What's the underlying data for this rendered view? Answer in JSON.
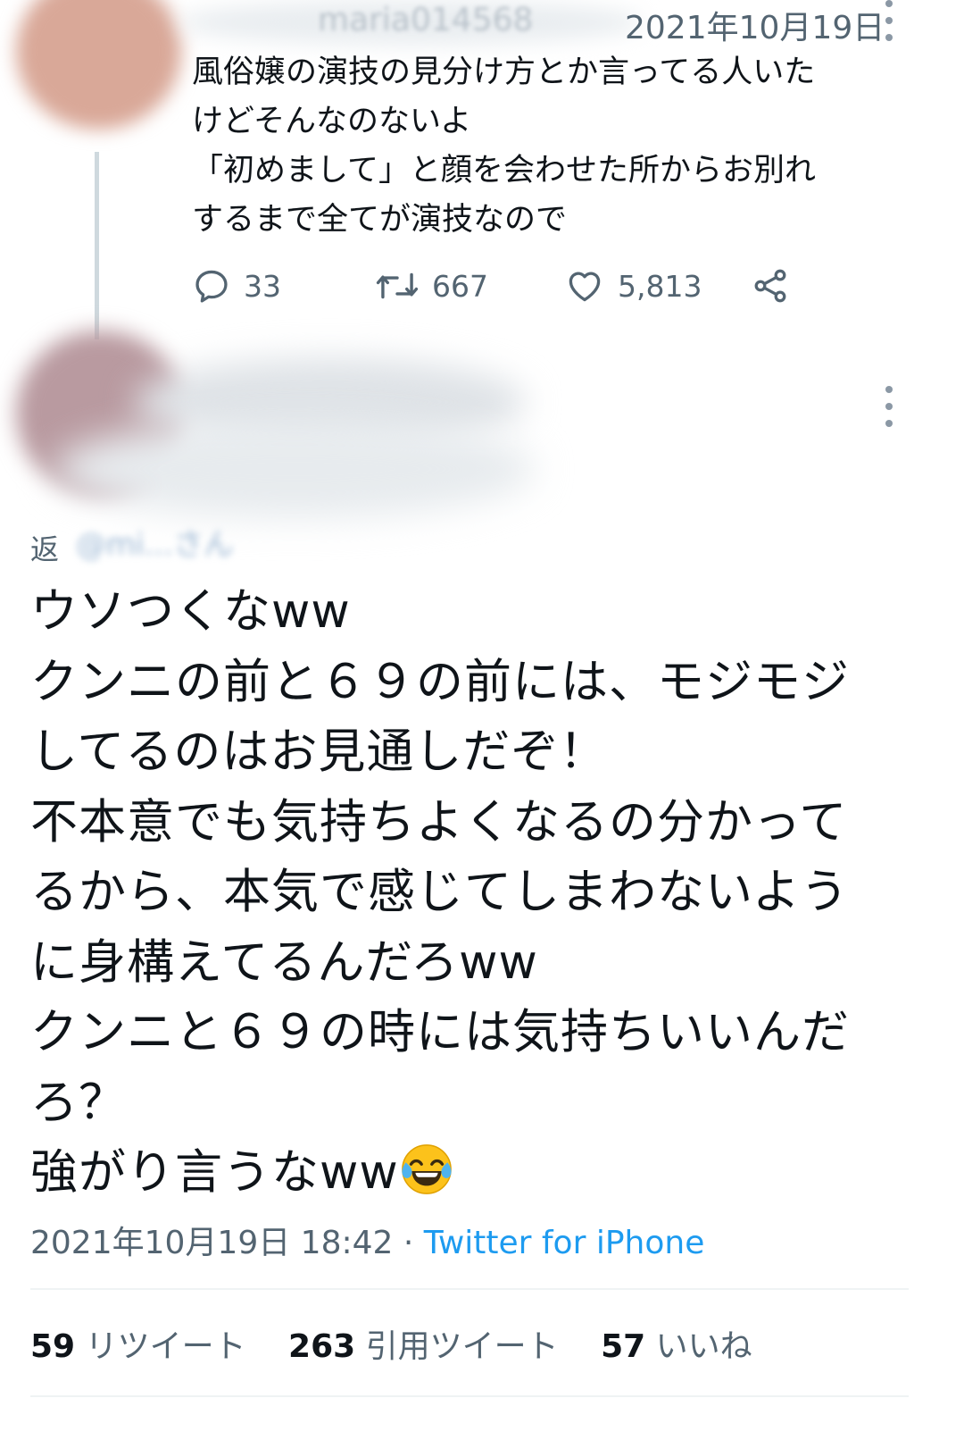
{
  "top_tweet": {
    "username": "maria014568",
    "date": "2021年10月19日",
    "lines": [
      "風俗嬢の演技の見分け方とか言ってる人いた",
      "けどそんなのないよ",
      "「初めまして」と顔を会わせた所からお別れ",
      "するまで全てが演技なので"
    ],
    "reply_count": "33",
    "retweet_count": "667",
    "like_count": "5,813"
  },
  "main_tweet": {
    "reply_prefix": "返",
    "reply_to_suffix": "@mi...さん",
    "lines": [
      "ウソつくなww",
      "クンニの前と６９の前には、モジモジ",
      "してるのはお見通しだぞ！",
      "不本意でも気持ちよくなるの分かって",
      "るから、本気で感じてしまわないよう",
      "に身構えてるんだろww",
      "クンニと６９の時には気持ちいいんだ",
      "ろ？",
      "強がり言うなww"
    ],
    "emoji": "face-with-tears-of-joy",
    "timestamp": "2021年10月19日 18:42",
    "separator": " · ",
    "source": "Twitter for iPhone",
    "retweets_count": "59",
    "retweets_label": "リツイート",
    "quotes_count": "263",
    "quotes_label": "引用ツイート",
    "likes_count": "57",
    "likes_label": "いいね"
  },
  "colors": {
    "text": "#0f1419",
    "secondary": "#536471",
    "link": "#1d9bf0",
    "divider": "#eff3f4"
  }
}
